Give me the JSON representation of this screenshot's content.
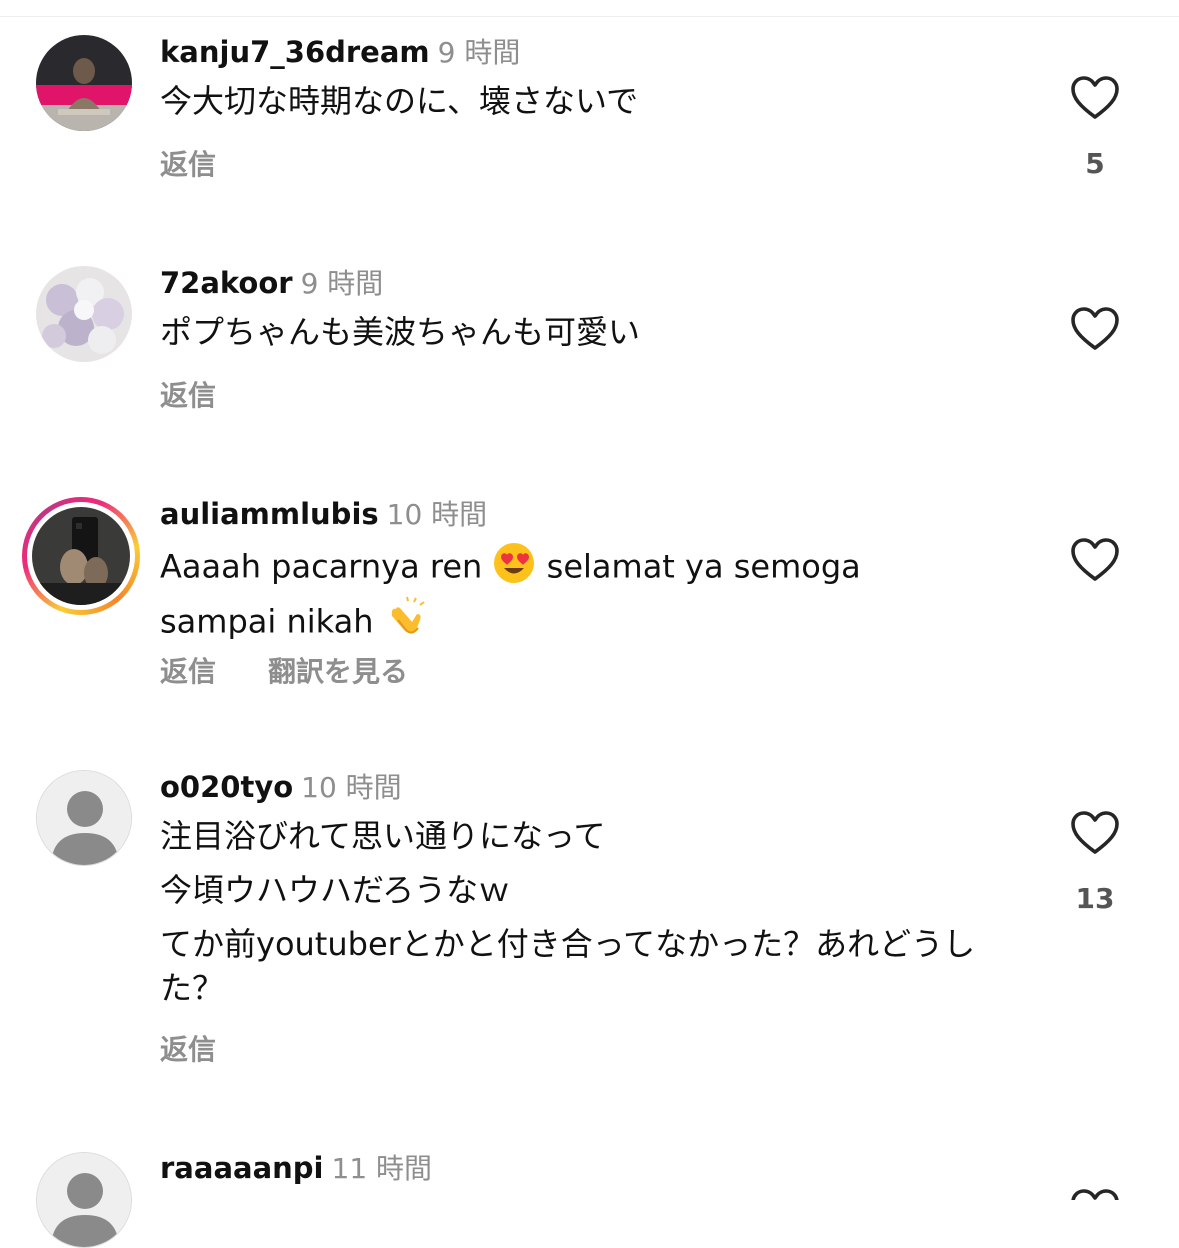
{
  "reply_label": "返信",
  "translate_label": "翻訳を見る",
  "comments": [
    {
      "username": "kanju7_36dream",
      "time": "9 時間",
      "text": "今大切な時期なのに、壊さないで",
      "likes": "5"
    },
    {
      "username": "72akoor",
      "time": "9 時間",
      "text": "ポプちゃんも美波ちゃんも可愛い",
      "likes": ""
    },
    {
      "username": "auliammlubis",
      "time": "10 時間",
      "text_part1": "Aaaah pacarnya ren",
      "text_part2": "selamat ya semoga",
      "text_part3": "sampai nikah",
      "likes": ""
    },
    {
      "username": "o020tyo",
      "time": "10 時間",
      "lines": [
        "注目浴びれて思い通りになって",
        "今頃ウハウハだろうなｗ",
        "てか前youtuberとかと付き合ってなかった？あれどうした？"
      ],
      "likes": "13"
    },
    {
      "username": "raaaaanpi",
      "time": "11 時間"
    }
  ]
}
